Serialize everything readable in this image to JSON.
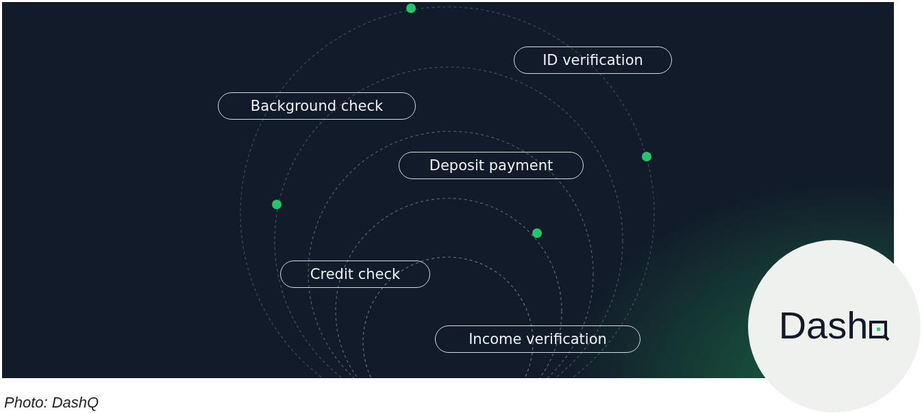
{
  "banner": {
    "tags": [
      {
        "label": "ID verification"
      },
      {
        "label": "Background check"
      },
      {
        "label": "Deposit payment"
      },
      {
        "label": "Credit check"
      },
      {
        "label": "Income verification"
      }
    ]
  },
  "logo": {
    "text": "Dash"
  },
  "caption": "Photo: DashQ"
}
